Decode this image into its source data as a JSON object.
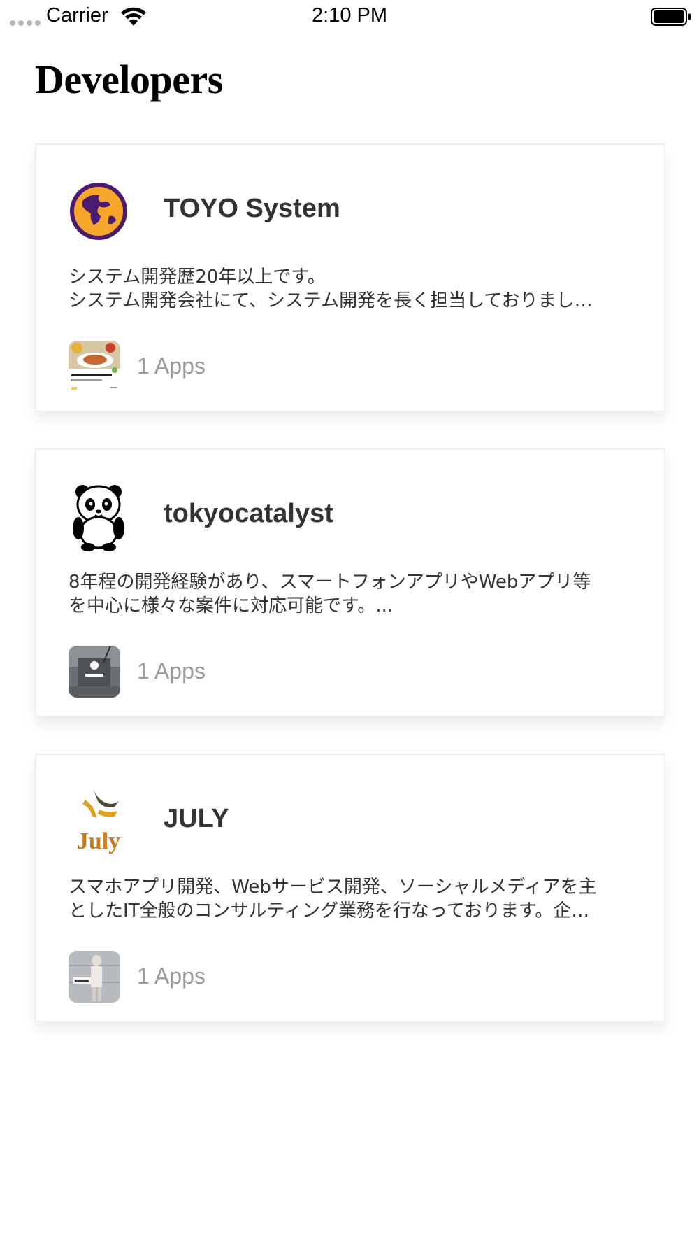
{
  "status_bar": {
    "carrier": "Carrier",
    "time": "2:10 PM",
    "wifi_icon": "wifi-icon",
    "battery_icon": "battery-full-icon"
  },
  "page": {
    "title": "Developers"
  },
  "developers": [
    {
      "name": "TOYO System",
      "avatar": "globe-logo",
      "description": "システム開発歴20年以上です。\nシステム開発会社にて、システム開発を長く担当しておりまし…",
      "apps_label": "1 Apps",
      "app_thumb": "food-app-thumbnail"
    },
    {
      "name": "tokyocatalyst",
      "avatar": "panda-logo",
      "description": "8年程の開発経験があり、スマートフォンアプリやWebアプリ等\nを中心に様々な案件に対応可能です。...",
      "apps_label": "1 Apps",
      "app_thumb": "beyond-app-thumbnail"
    },
    {
      "name": "JULY",
      "avatar": "july-logo",
      "description": "スマホアプリ開発、Webサービス開発、ソーシャルメディアを主\nとしたIT全般のコンサルティング業務を行なっております。企…",
      "apps_label": "1 Apps",
      "app_thumb": "fashion-app-thumbnail"
    }
  ]
}
